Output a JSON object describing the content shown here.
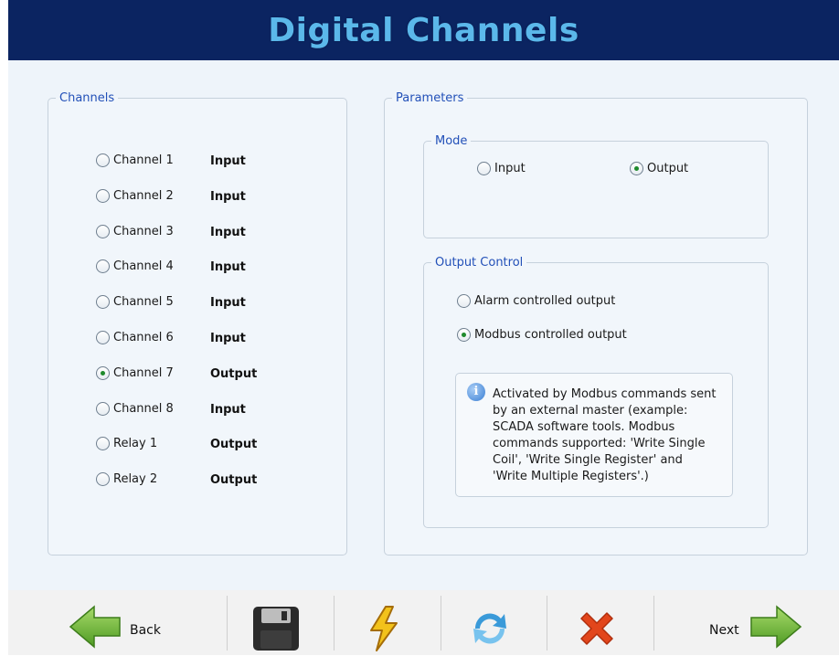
{
  "title": "Digital Channels",
  "channels": {
    "legend": "Channels",
    "items": [
      {
        "name": "Channel 1",
        "type": "Input",
        "selected": false
      },
      {
        "name": "Channel 2",
        "type": "Input",
        "selected": false
      },
      {
        "name": "Channel 3",
        "type": "Input",
        "selected": false
      },
      {
        "name": "Channel 4",
        "type": "Input",
        "selected": false
      },
      {
        "name": "Channel 5",
        "type": "Input",
        "selected": false
      },
      {
        "name": "Channel 6",
        "type": "Input",
        "selected": false
      },
      {
        "name": "Channel 7",
        "type": "Output",
        "selected": true
      },
      {
        "name": "Channel 8",
        "type": "Input",
        "selected": false
      },
      {
        "name": "Relay 1",
        "type": "Output",
        "selected": false
      },
      {
        "name": "Relay 2",
        "type": "Output",
        "selected": false
      }
    ]
  },
  "parameters": {
    "legend": "Parameters",
    "mode": {
      "legend": "Mode",
      "options": [
        {
          "label": "Input",
          "selected": false
        },
        {
          "label": "Output",
          "selected": true
        }
      ]
    },
    "output_control": {
      "legend": "Output Control",
      "options": [
        {
          "label": "Alarm controlled output",
          "selected": false
        },
        {
          "label": "Modbus controlled output",
          "selected": true
        }
      ],
      "info_lines": [
        "Activated by Modbus commands sent",
        "by an external master (example:",
        "SCADA software tools. Modbus",
        "commands supported: 'Write Single",
        "Coil', 'Write Single Register' and",
        "'Write Multiple Registers'.)"
      ]
    }
  },
  "toolbar": {
    "back_label": "Back",
    "next_label": "Next",
    "icons": [
      "back-arrow-icon",
      "save-disk-icon",
      "lightning-icon",
      "refresh-icon",
      "close-x-icon",
      "next-arrow-icon"
    ],
    "colors": {
      "arrow": "#6fb536",
      "close": "#e2461c",
      "refresh": "#3a9ad9",
      "lightning": "#f2c21b"
    }
  }
}
